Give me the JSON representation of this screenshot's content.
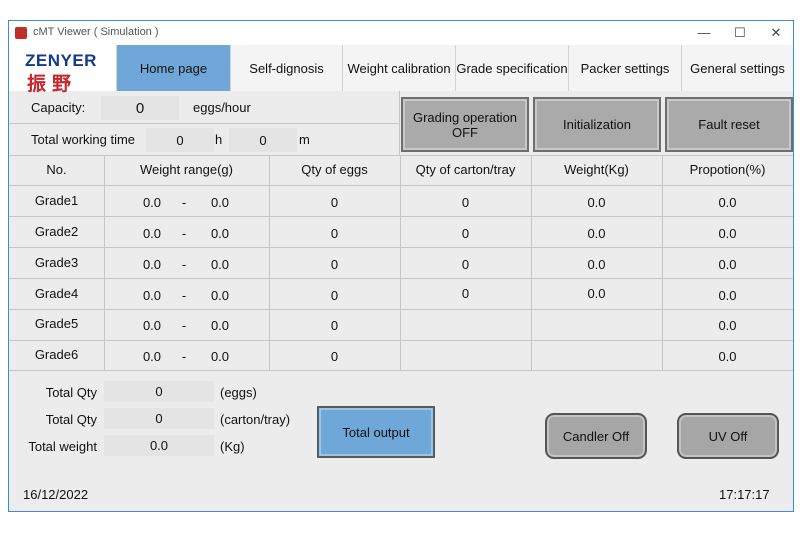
{
  "window": {
    "title": "cMT Viewer ( Simulation )",
    "min_glyph": "—",
    "max_glyph": "☐",
    "close_glyph": "✕"
  },
  "logo": {
    "en": "ZENYER",
    "cn": "振野"
  },
  "tabs": [
    "Home page",
    "Self-dignosis",
    "Weight calibration",
    "Grade specification",
    "Packer settings",
    "General settings"
  ],
  "capacity": {
    "label": "Capacity:",
    "value": "0",
    "unit": "eggs/hour"
  },
  "working_time": {
    "label": "Total working time",
    "hours": "0",
    "h_unit": "h",
    "minutes": "0",
    "m_unit": "m"
  },
  "buttons": {
    "grading_line1": "Grading operation",
    "grading_line2": "OFF",
    "initialization": "Initialization",
    "fault_reset": "Fault reset",
    "total_output": "Total output",
    "candler": "Candler Off",
    "uv": "UV Off"
  },
  "table": {
    "headers": [
      "No.",
      "Weight range(g)",
      "Qty of eggs",
      "Qty of carton/tray",
      "Weight(Kg)",
      "Propotion(%)"
    ],
    "rows": [
      {
        "no": "Grade1",
        "min": "0.0",
        "sep": "-",
        "max": "0.0",
        "eggs": "0",
        "carton": "0",
        "weight": "0.0",
        "prop": "0.0"
      },
      {
        "no": "Grade2",
        "min": "0.0",
        "sep": "-",
        "max": "0.0",
        "eggs": "0",
        "carton": "0",
        "weight": "0.0",
        "prop": "0.0"
      },
      {
        "no": "Grade3",
        "min": "0.0",
        "sep": "-",
        "max": "0.0",
        "eggs": "0",
        "carton": "0",
        "weight": "0.0",
        "prop": "0.0"
      },
      {
        "no": "Grade4",
        "min": "0.0",
        "sep": "-",
        "max": "0.0",
        "eggs": "0",
        "carton": "0",
        "weight": "0.0",
        "prop": "0.0"
      },
      {
        "no": "Grade5",
        "min": "0.0",
        "sep": "-",
        "max": "0.0",
        "eggs": "0",
        "carton": "",
        "weight": "",
        "prop": "0.0"
      },
      {
        "no": "Grade6",
        "min": "0.0",
        "sep": "-",
        "max": "0.0",
        "eggs": "0",
        "carton": "",
        "weight": "",
        "prop": "0.0"
      }
    ]
  },
  "totals": [
    {
      "label": "Total Qty",
      "value": "0",
      "unit": "(eggs)"
    },
    {
      "label": "Total Qty",
      "value": "0",
      "unit": "(carton/tray)"
    },
    {
      "label": "Total weight",
      "value": "0.0",
      "unit": "(Kg)"
    }
  ],
  "status": {
    "date": "16/12/2022",
    "time": "17:17:17"
  }
}
